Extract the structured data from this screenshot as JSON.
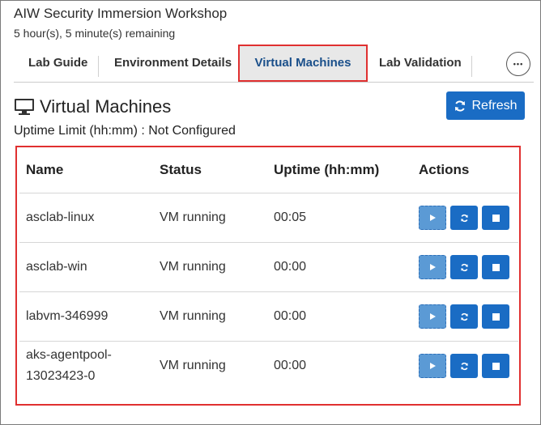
{
  "header": {
    "title": "AIW Security Immersion Workshop",
    "subtitle": "5 hour(s), 5 minute(s) remaining"
  },
  "tabs": [
    {
      "label": "Lab Guide",
      "active": false
    },
    {
      "label": "Environment Details",
      "active": false
    },
    {
      "label": "Virtual Machines",
      "active": true
    },
    {
      "label": "Lab Validation",
      "active": false
    }
  ],
  "more_button": {
    "icon": "ellipsis-icon",
    "label": "•••"
  },
  "section": {
    "icon": "monitor-icon",
    "title": "Virtual Machines",
    "refresh_label": "Refresh",
    "uptime_limit": "Uptime Limit (hh:mm) : Not Configured"
  },
  "table": {
    "headers": [
      "Name",
      "Status",
      "Uptime (hh:mm)",
      "Actions"
    ],
    "rows": [
      {
        "name": "asclab-linux",
        "status": "VM running",
        "uptime": "00:05"
      },
      {
        "name": "asclab-win",
        "status": "VM running",
        "uptime": "00:00"
      },
      {
        "name": "labvm-346999",
        "status": "VM running",
        "uptime": "00:00"
      },
      {
        "name": "aks-agentpool-13023423-0",
        "status": "VM running",
        "uptime": "00:00"
      }
    ]
  },
  "colors": {
    "accent": "#1a6cc4",
    "highlight": "#e03030",
    "start_disabled": "#5b9ad5"
  }
}
